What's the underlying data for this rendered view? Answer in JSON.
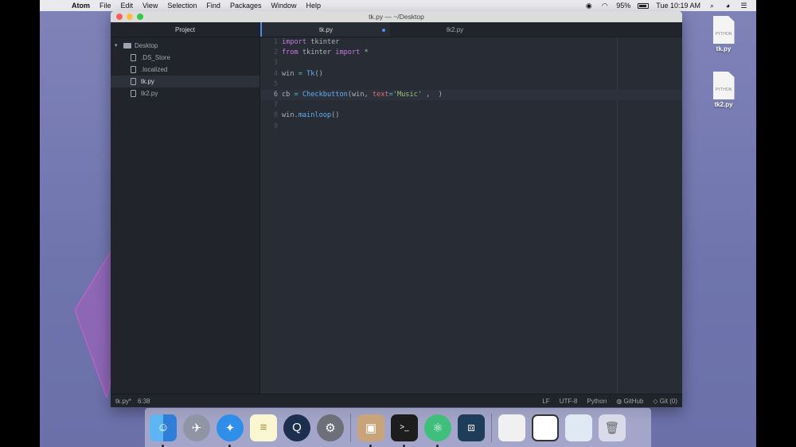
{
  "menubar": {
    "app": "Atom",
    "menus": [
      "File",
      "Edit",
      "View",
      "Selection",
      "Find",
      "Packages",
      "Window",
      "Help"
    ],
    "battery": "95%",
    "clock": "Tue 10:19 AM"
  },
  "window": {
    "title": "tk.py — ~/Desktop"
  },
  "tree": {
    "header": "Project",
    "folder": "Desktop",
    "files": [
      ".DS_Store",
      ".localized",
      "tk.py",
      "tk2.py"
    ]
  },
  "tabs": [
    {
      "label": "tk.py",
      "modified": true
    },
    {
      "label": "tk2.py",
      "modified": false
    }
  ],
  "code": {
    "line_numbers": [
      "1",
      "2",
      "3",
      "4",
      "5",
      "6",
      "7",
      "8",
      "9"
    ]
  },
  "status": {
    "file": "tk.py*",
    "cursor": "6:38",
    "line_ending": "LF",
    "encoding": "UTF-8",
    "grammar": "Python",
    "github": "GitHub",
    "git": "Git (0)"
  },
  "desktop": {
    "icons": [
      {
        "name": "tk.py",
        "type": "PYTHON"
      },
      {
        "name": "tk2.py",
        "type": "PYTHON"
      }
    ]
  },
  "colors": {
    "accent": "#568af2",
    "editor_bg": "#282c34",
    "keyword": "#c678dd",
    "function": "#61afef",
    "string": "#98c379"
  }
}
